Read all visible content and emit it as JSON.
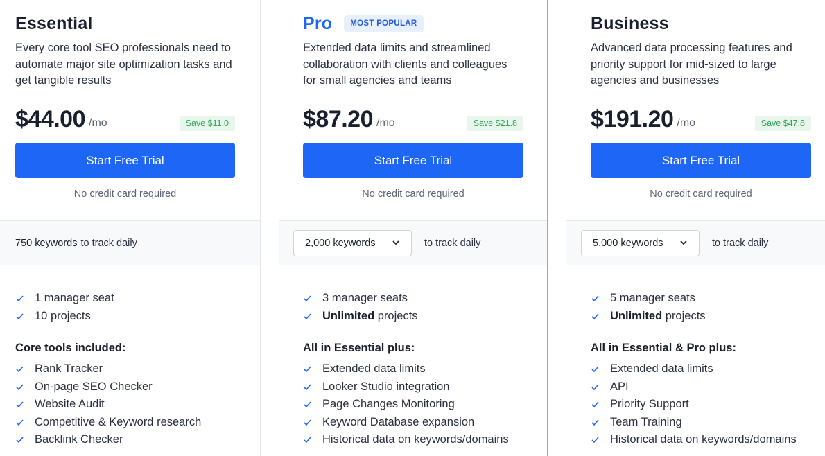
{
  "plans": [
    {
      "name": "Essential",
      "badge": "",
      "description": "Every core tool SEO professionals need to automate major site optimization tasks and get tangible results",
      "price": "$44.00",
      "per": "/mo",
      "save": "Save $11.0",
      "cta": "Start Free Trial",
      "note": "No credit card required",
      "keywords": {
        "value": "750 keywords",
        "suffix": "to track daily",
        "selectable": false
      },
      "seats": {
        "count": "1",
        "label": "manager seat"
      },
      "projects": {
        "count": "10",
        "label": "projects"
      },
      "group_title": "Core tools included:",
      "features": [
        "Rank Tracker",
        "On-page SEO Checker",
        "Website Audit",
        "Competitive & Keyword research",
        "Backlink Checker"
      ]
    },
    {
      "name": "Pro",
      "badge": "MOST POPULAR",
      "description": "Extended data limits and streamlined collaboration with clients and colleagues for small agencies and teams",
      "price": "$87.20",
      "per": "/mo",
      "save": "Save $21.8",
      "cta": "Start Free Trial",
      "note": "No credit card required",
      "keywords": {
        "value": "2,000 keywords",
        "suffix": "to track daily",
        "selectable": true
      },
      "seats": {
        "count": "3",
        "label": "manager seats"
      },
      "projects": {
        "count": "Unlimited",
        "label": "projects"
      },
      "group_title": "All in Essential plus:",
      "features": [
        "Extended data limits",
        "Looker Studio integration",
        "Page Changes Monitoring",
        "Keyword Database expansion",
        "Historical data on keywords/domains"
      ]
    },
    {
      "name": "Business",
      "badge": "",
      "description": "Advanced data processing features and priority support for mid-sized to large agencies and businesses",
      "price": "$191.20",
      "per": "/mo",
      "save": "Save $47.8",
      "cta": "Start Free Trial",
      "note": "No credit card required",
      "keywords": {
        "value": "5,000 keywords",
        "suffix": "to track daily",
        "selectable": true
      },
      "seats": {
        "count": "5",
        "label": "manager seats"
      },
      "projects": {
        "count": "Unlimited",
        "label": "projects"
      },
      "group_title": "All in Essential & Pro plus:",
      "features": [
        "Extended data limits",
        "API",
        "Priority Support",
        "Team Training",
        "Historical data on keywords/domains"
      ]
    }
  ],
  "colors": {
    "accent": "#1e66f5",
    "check": "#1e66f5",
    "save_bg": "#e8f6ec",
    "save_text": "#2fa35a",
    "badge_bg": "#e8effd"
  },
  "icons": {
    "check": "check-icon",
    "dropdown": "chevron-down-icon"
  }
}
